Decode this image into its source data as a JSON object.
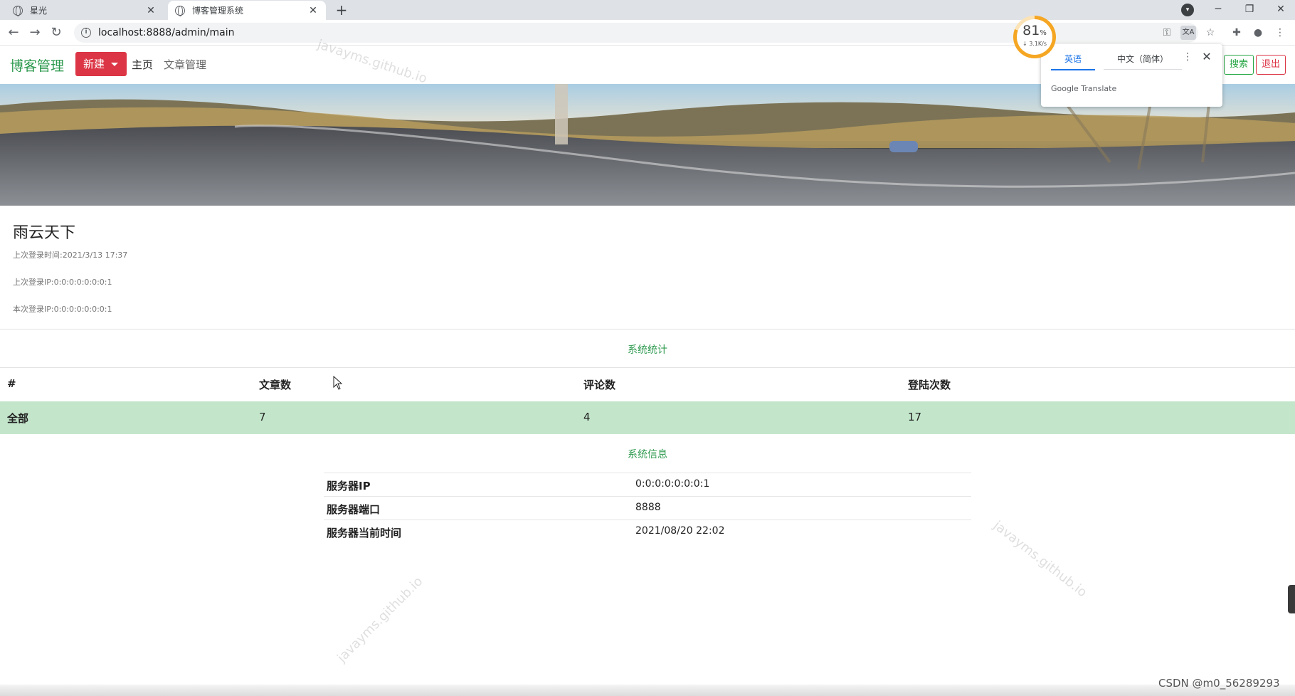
{
  "browser": {
    "tabs": [
      {
        "label": "星光",
        "active": false
      },
      {
        "label": "博客管理系统",
        "active": true
      }
    ],
    "url": "localhost:8888/admin/main",
    "speed_widget": {
      "percent": 81,
      "percent_unit": "%",
      "rate": "↓ 3.1K/s",
      "accent": "#f5a623"
    },
    "translate_popup": {
      "tab_english": "英语",
      "tab_chinese": "中文（简体）",
      "brand": "Google Translate"
    },
    "icons": [
      "back-icon",
      "forward-icon",
      "reload-icon",
      "info-icon",
      "key-icon",
      "translate-icon",
      "star-icon",
      "extensions-icon",
      "profile-icon",
      "menu-icon"
    ]
  },
  "navbar": {
    "brand": "博客管理",
    "new_button": "新建",
    "links": {
      "home": "主页",
      "articles": "文章管理"
    },
    "search_button": "搜索",
    "logout_button": "退出",
    "colors": {
      "brand": "#2e9a4f",
      "danger": "#dc3545",
      "success": "#28a745"
    }
  },
  "profile": {
    "name": "雨云天下",
    "last_login_time": "上次登录时间:2021/3/13 17:37",
    "last_login_ip": "上次登录IP:0:0:0:0:0:0:0:1",
    "current_login_ip": "本次登录IP:0:0:0:0:0:0:0:1"
  },
  "stats": {
    "title": "系统统计",
    "headers": [
      "#",
      "文章数",
      "评论数",
      "登陆次数"
    ],
    "row": [
      "全部",
      "7",
      "4",
      "17"
    ],
    "row_color": "#c3e6cb"
  },
  "system_info": {
    "title": "系统信息",
    "rows": [
      {
        "key": "服务器IP",
        "value": "0:0:0:0:0:0:0:1"
      },
      {
        "key": "服务器端口",
        "value": "8888"
      },
      {
        "key": "服务器当前时间",
        "value": "2021/08/20 22:02"
      }
    ]
  },
  "watermark": "javayms.github.io",
  "footer_credit": "CSDN @m0_56289293"
}
